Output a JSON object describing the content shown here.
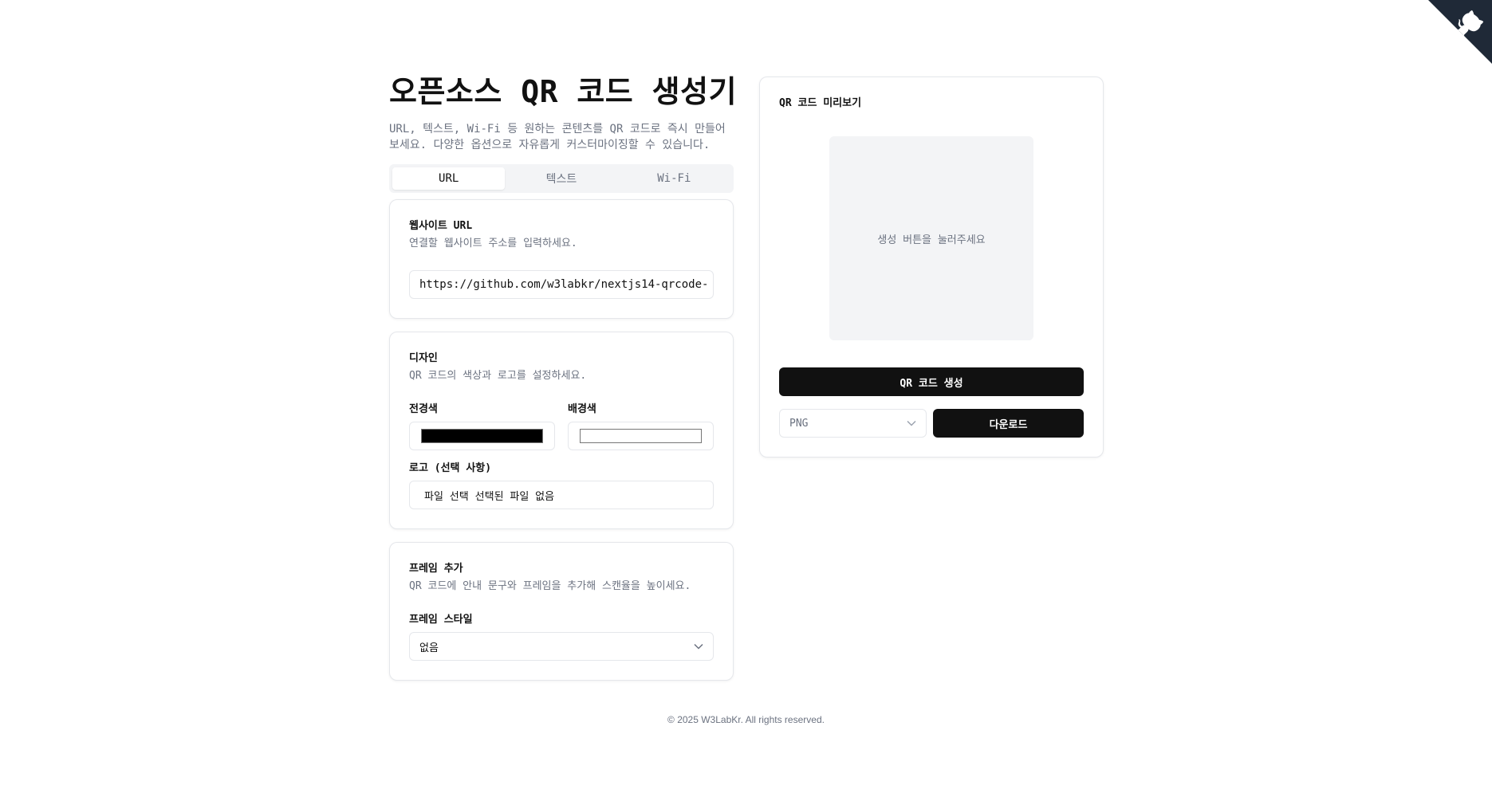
{
  "header": {
    "title": "오픈소스 QR 코드 생성기",
    "description": "URL, 텍스트, Wi-Fi 등 원하는 콘텐츠를 QR 코드로 즉시 만들어보세요. 다양한 옵션으로 자유롭게 커스터마이징할 수 있습니다."
  },
  "tabs": [
    {
      "label": "URL",
      "active": true
    },
    {
      "label": "텍스트",
      "active": false
    },
    {
      "label": "Wi-Fi",
      "active": false
    }
  ],
  "url_card": {
    "title": "웹사이트 URL",
    "description": "연결할 웹사이트 주소를 입력하세요.",
    "value": "https://github.com/w3labkr/nextjs14-qrcode-"
  },
  "design_card": {
    "title": "디자인",
    "description": "QR 코드의 색상과 로고를 설정하세요.",
    "fg_label": "전경색",
    "fg_color": "#000000",
    "bg_label": "배경색",
    "bg_color": "#ffffff",
    "logo_label": "로고 (선택 사항)",
    "file_button": "파일 선택",
    "file_status": "선택된 파일 없음"
  },
  "frame_card": {
    "title": "프레임 추가",
    "description": "QR 코드에 안내 문구와 프레임을 추가해 스캔율을 높이세요.",
    "style_label": "프레임 스타일",
    "style_value": "없음"
  },
  "preview": {
    "title": "QR 코드 미리보기",
    "placeholder": "생성 버튼을 눌러주세요",
    "generate_label": "QR 코드 생성",
    "format_value": "PNG",
    "download_label": "다운로드"
  },
  "footer": {
    "text": "© 2025 W3LabKr. All rights reserved."
  },
  "colors": {
    "primary": "#111111",
    "muted": "#6b7280",
    "border": "#e5e7eb",
    "surface": "#f3f4f6",
    "corner": "#1f2937"
  },
  "icons": {
    "corner": "github-corner-icon",
    "select": "chevron-down-icon"
  }
}
